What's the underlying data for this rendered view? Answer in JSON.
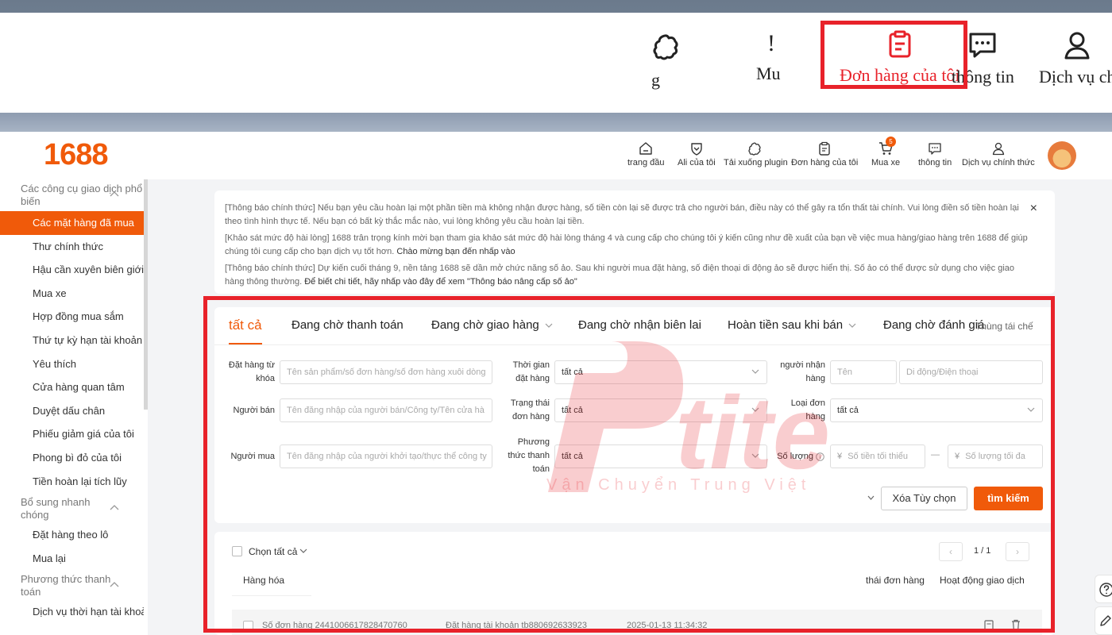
{
  "zoom_header": {
    "items": [
      {
        "label": "g",
        "icon": "puzzle-icon"
      },
      {
        "label": "Mu",
        "icon": "cart-icon"
      },
      {
        "label": "Đơn hàng của tôi",
        "icon": "clipboard-icon"
      },
      {
        "label": "thông tin",
        "icon": "chat-icon"
      },
      {
        "label": "Dịch vụ ch",
        "icon": "user-icon"
      }
    ],
    "partial_glyph": "!",
    "highlight_color": "#e8222a"
  },
  "header": {
    "logo": "1688",
    "nav": [
      {
        "label": "trang đầu",
        "icon": "home-icon"
      },
      {
        "label": "Ali của tôi",
        "icon": "heart-shield-icon"
      },
      {
        "label": "Tải xuống plugin",
        "icon": "puzzle-icon"
      },
      {
        "label": "Đơn hàng của tôi",
        "icon": "clipboard-icon"
      },
      {
        "label": "Mua xe",
        "icon": "cart-icon",
        "badge": "5"
      },
      {
        "label": "thông tin",
        "icon": "chat-icon"
      },
      {
        "label": "Dịch vụ chính thức",
        "icon": "user-icon"
      }
    ],
    "brand_color": "#f05a0a"
  },
  "sidebar": {
    "groups": [
      {
        "title": "Các công cụ giao dịch phổ biến",
        "items": [
          "Các mặt hàng đã mua",
          "Thư chính thức",
          "Hậu cần xuyên biên giới",
          "Mua xe",
          "Hợp đồng mua sắm",
          "Thứ tự kỳ hạn tài khoản",
          "Yêu thích",
          "Cửa hàng quan tâm",
          "Duyệt dấu chân",
          "Phiếu giảm giá của tôi",
          "Phong bì đỏ của tôi",
          "Tiền hoàn lại tích lũy"
        ]
      },
      {
        "title": "Bổ sung nhanh chóng",
        "items": [
          "Đặt hàng theo lô",
          "Mua lại"
        ]
      },
      {
        "title": "Phương thức thanh toán",
        "items": [
          "Dịch vụ thời hạn tài khoả"
        ]
      }
    ],
    "active_item": "Các mặt hàng đã mua"
  },
  "notice": {
    "lines": [
      "[Thông báo chính thức] Nếu bạn yêu cầu hoàn lại một phần tiền mà không nhận được hàng, số tiền còn lại sẽ được trả cho người bán, điều này có thể gây ra tổn thất tài chính. Vui lòng điền số tiền hoàn lại theo tình hình thực tế. Nếu bạn có bất kỳ thắc mắc nào, vui lòng không yêu cầu hoàn lại tiền.",
      "[Khảo sát mức độ hài lòng] 1688 trân trọng kính mời bạn tham gia khảo sát mức độ hài lòng tháng 4 và cung cấp cho chúng tôi ý kiến cũng như đề xuất của bạn về việc mua hàng/giao hàng trên 1688 để giúp chúng tôi cung cấp cho bạn dịch vụ tốt hơn.",
      "[Thông báo chính thức] Dự kiến cuối tháng 9, nền tảng 1688 sẽ dần mở chức năng số ảo. Sau khi người mua đặt hàng, số điện thoại di động ảo sẽ được hiển thị. Số ảo có thể được sử dụng cho việc giao hàng thông thường."
    ],
    "link_survey": "Chào mừng bạn đến nhấp vào",
    "link_virtual": "Để biết chi tiết, hãy nhấp vào đây để xem \"Thông báo nâng cấp số ảo\"",
    "close": "×"
  },
  "tabs": {
    "items": [
      "tất cả",
      "Đang chờ thanh toán",
      "Đang chờ giao hàng",
      "Đang chờ nhận biên lai",
      "Hoàn tiền sau khi bán",
      "Đang chờ đánh giá"
    ],
    "right": "Thùng tái chế"
  },
  "filters": {
    "keyword": {
      "label": "Đặt hàng từ khóa",
      "placeholder": "Tên sản phẩm/số đơn hàng/số đơn hàng xuôi dòng"
    },
    "order_time": {
      "label": "Thời gian đặt hàng",
      "value": "tất cả"
    },
    "receiver": {
      "label": "người nhận hàng",
      "name_placeholder": "Tên",
      "phone_placeholder": "Di động/Điện thoại"
    },
    "seller": {
      "label": "Người bán",
      "placeholder": "Tên đăng nhập của người bán/Công ty/Tên cửa hà"
    },
    "order_status": {
      "label": "Trạng thái đơn hàng",
      "value": "tất cả"
    },
    "order_type": {
      "label": "Loại đơn hàng",
      "value": "tất cả"
    },
    "buyer": {
      "label": "Người mua",
      "placeholder": "Tên đăng nhập của người khởi tạo/thực thể công ty"
    },
    "payment_method": {
      "label": "Phương thức thanh toán",
      "value": "tất cả"
    },
    "quantity": {
      "label": "Số lượng",
      "min_placeholder": "Số tiền tối thiểu",
      "max_placeholder": "Số lượng tối đa",
      "currency": "¥",
      "separator": "—"
    },
    "clear_button": "Xóa Tùy chọn",
    "search_button": "tìm kiếm"
  },
  "list": {
    "select_all": "Chọn tất cả",
    "pager": {
      "prev": "‹",
      "page": "1 / 1",
      "next": "›"
    },
    "columns": [
      "Hàng hóa",
      "thái đơn hàng",
      "Hoạt động giao dịch"
    ],
    "order": {
      "order_no": "Số đơn hàng  2441006617828470760",
      "account": "Đặt hàng tài khoản  tb880692633923",
      "time": "2025-01-13 11:34:32"
    }
  },
  "watermark": {
    "brand": "P'tite",
    "tagline": "Vận Chuyển Trung Việt"
  }
}
